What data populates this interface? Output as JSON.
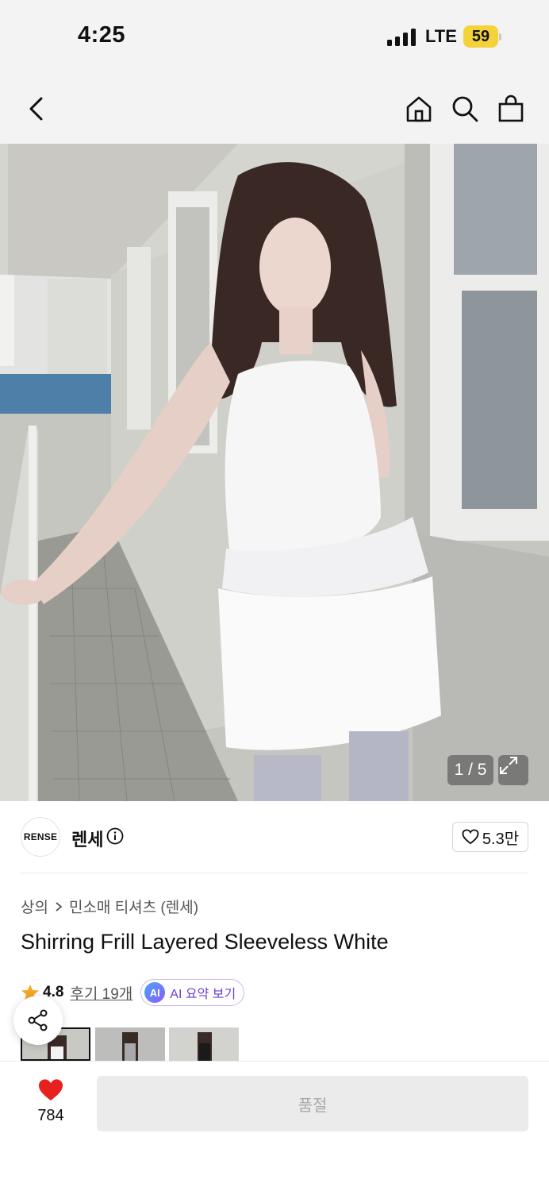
{
  "status_bar": {
    "time": "4:25",
    "network": "LTE",
    "battery": "59",
    "battery_color": "#f4d33a"
  },
  "nav": {
    "icons": [
      "back-icon",
      "home-icon",
      "search-icon",
      "shopping-bag-icon"
    ]
  },
  "gallery": {
    "counter": "1 / 5",
    "expand_icon": "expand-icon"
  },
  "brand": {
    "logo_text": "RENSE",
    "name": "렌세",
    "likes": "5.3만"
  },
  "product": {
    "breadcrumb": [
      "상의",
      "민소매 티셔츠 (렌세)"
    ],
    "title": "Shirring Frill Layered Sleeveless White",
    "rating": "4.8",
    "reviews": "후기 19개",
    "ai_badge": "AI",
    "ai_label": "AI 요약 보기",
    "star_color": "#f5a623",
    "ai_color": "#6a3fd6"
  },
  "bottom_bar": {
    "wish_count": "784",
    "heart_color": "#e8201e",
    "buy_label": "품절"
  }
}
